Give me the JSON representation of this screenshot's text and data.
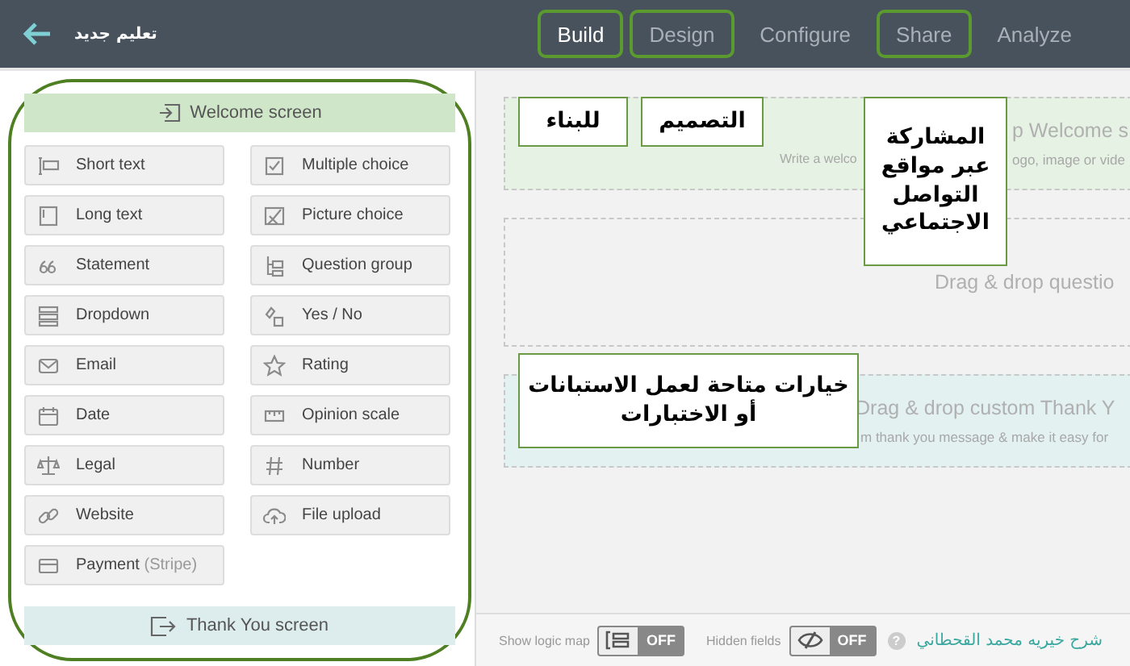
{
  "topbar": {
    "title": "تعليم جديد",
    "tabs": [
      {
        "label": "Build",
        "selected": true,
        "highlighted": true
      },
      {
        "label": "Design",
        "selected": false,
        "highlighted": true
      },
      {
        "label": "Configure",
        "selected": false,
        "highlighted": false
      },
      {
        "label": "Share",
        "selected": false,
        "highlighted": true
      },
      {
        "label": "Analyze",
        "selected": false,
        "highlighted": false
      }
    ]
  },
  "sidebar": {
    "welcome": "Welcome screen",
    "items": [
      {
        "label": "Short text"
      },
      {
        "label": "Multiple choice"
      },
      {
        "label": "Long text"
      },
      {
        "label": "Picture choice"
      },
      {
        "label": "Statement"
      },
      {
        "label": "Question group"
      },
      {
        "label": "Dropdown"
      },
      {
        "label": "Yes / No"
      },
      {
        "label": "Email"
      },
      {
        "label": "Rating"
      },
      {
        "label": "Date"
      },
      {
        "label": "Opinion scale"
      },
      {
        "label": "Legal"
      },
      {
        "label": "Number"
      },
      {
        "label": "Website"
      },
      {
        "label": "File upload"
      },
      {
        "label": "Payment",
        "note": "(Stripe)"
      }
    ],
    "thank_you": "Thank You screen"
  },
  "canvas": {
    "welcome_zone": {
      "heading": "p Welcome s",
      "hint_parts": [
        "Write a welco",
        "ogo, image or vide"
      ]
    },
    "questions_zone": {
      "heading": "Drag & drop questio"
    },
    "thank_you_zone": {
      "heading": "Drag & drop custom Thank Y",
      "hint": "m thank you message & make it easy for"
    }
  },
  "callouts": [
    {
      "text": "للبناء"
    },
    {
      "text": "التصميم"
    },
    {
      "text": "المشاركة عبر مواقع التواصل الاجتماعي"
    },
    {
      "text": "خيارات متاحة لعمل الاستبانات أو الاختبارات"
    }
  ],
  "footer": {
    "toggles": [
      {
        "label": "Show logic map",
        "state": "OFF",
        "on": false
      },
      {
        "label": "Hidden fields",
        "state": "OFF",
        "on": false
      }
    ],
    "help": "?",
    "credit": "شرح خيريه محمد القحطاني"
  }
}
